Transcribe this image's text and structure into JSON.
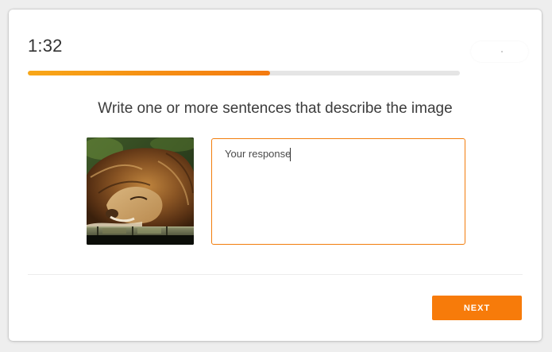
{
  "timer": {
    "text": "1:32"
  },
  "progress": {
    "fraction": 0.56
  },
  "prompt": {
    "text": "Write one or more sentences that describe the image"
  },
  "image": {
    "subject": "sleeping lion lying on wooden planks"
  },
  "response": {
    "placeholder": "Your response",
    "value": ""
  },
  "footer": {
    "next_label": "NEXT"
  },
  "icons": {
    "corner": "menu-dots-icon"
  },
  "colors": {
    "accent": "#f27d0c",
    "progress_start": "#f8a718",
    "progress_end": "#f47a10",
    "track": "#e5e5e5",
    "next_button": "#f77b0a"
  }
}
